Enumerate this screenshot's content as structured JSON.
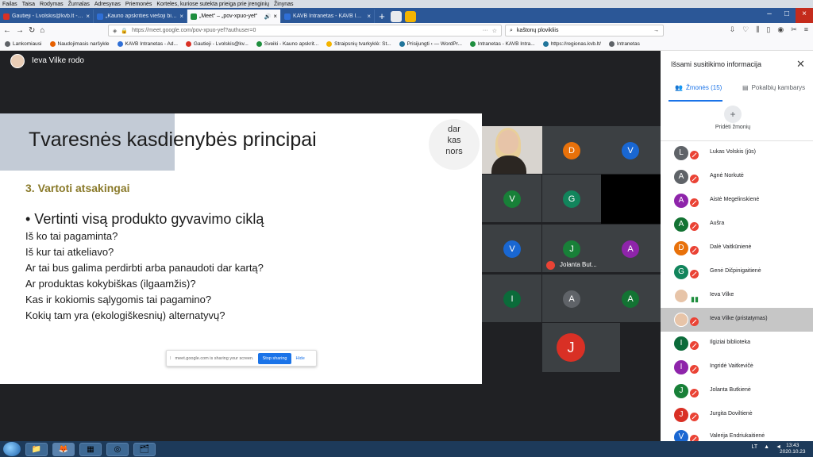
{
  "menu": [
    "Failas",
    "Taisa",
    "Rodymas",
    "Žurnalas",
    "Adresynas",
    "Priemonės",
    "Korteles, kuriose sutekta prieiga prie įrenginių",
    "Žinynas"
  ],
  "tabs": [
    {
      "title": "Gautieji - Lvolskis@kvb.lt - Kaun",
      "color": "#d93025"
    },
    {
      "title": "„Kauno apskrities viešoji biblioteka",
      "color": "#2f6fd6"
    },
    {
      "title": "„Meet“ – „pov-xpuo-yef“",
      "color": "#1e8e3e",
      "active": true
    },
    {
      "title": "KAVB Intranetas - KAVB Intranet",
      "color": "#2f6fd6"
    }
  ],
  "url": "https://meet.google.com/pov-xpuo-yef?authuser=0",
  "search_value": "kaštonų plovikliis",
  "bookmarks": [
    "Lankomiausi",
    "Naudojimasis naršykle",
    "KAVB Intranetas - Ad...",
    "Gautieji - Lvolskis@kv...",
    "Sveiki - Kauno apskrit...",
    "Straipsnių tvarkyklė: St...",
    "Prisijungti ‹ — WordPr...",
    "Intranetas - KAVB Intra...",
    "https://regionas.kvb.lt/",
    "Intranetas"
  ],
  "presenter": "Ieva Vilke rodo",
  "slide": {
    "title": "Tvaresnės kasdienybės principai",
    "logo": [
      "dar",
      "kas",
      "nors"
    ],
    "subtitle": "3. Vartoti atsakingai",
    "bullet": "• Vertinti visą produkto gyvavimo ciklą",
    "questions": [
      "Iš ko tai pagaminta?",
      "Iš kur tai atkeliavo?",
      "Ar tai bus galima perdirbti arba panaudoti dar kartą?",
      "Ar produktas kokybiškas (ilgaamžis)?",
      "Kas ir kokiomis sąlygomis tai pagamino?",
      "Kokių tam yra (ekologiškesnių) alternatyvų?"
    ]
  },
  "sharebar": {
    "text": "meet.google.com is sharing your screen.",
    "stop": "Stop sharing",
    "hide": "Hide"
  },
  "tiles": [
    {
      "letter": "D",
      "color": "#e8710a"
    },
    {
      "letter": "V",
      "color": "#1967d2"
    },
    {
      "letter": "V",
      "color": "#188038"
    },
    {
      "letter": "G",
      "color": "#12855c"
    },
    {
      "letter": "V",
      "color": "#1967d2"
    },
    {
      "letter": "J",
      "color": "#188038"
    },
    {
      "letter": "A",
      "color": "#8e24aa"
    },
    {
      "letter": "I",
      "color": "#0b6b3a"
    },
    {
      "letter": "A",
      "color": "#5f6368"
    },
    {
      "letter": "A",
      "color": "#137333"
    },
    {
      "letter": "J",
      "color": "#d93025"
    }
  ],
  "jolanta_label": "Jolanta But...",
  "panel": {
    "title": "Išsami susitikimo informacija",
    "tab_people": "Žmonės (15)",
    "tab_chat": "Pokalbių kambarys",
    "add_people": "Pridėti žmonių",
    "people": [
      {
        "initial": "L",
        "name": "Lukas Volskis (jūs)",
        "color": "#5f6368",
        "muted": true
      },
      {
        "initial": "A",
        "name": "Agnė Norkutė",
        "color": "#5f6368",
        "muted": true
      },
      {
        "initial": "A",
        "name": "Aistė Megelinskienė",
        "color": "#8e24aa",
        "muted": true
      },
      {
        "initial": "A",
        "name": "Aušra",
        "color": "#137333",
        "muted": true
      },
      {
        "initial": "D",
        "name": "Dalė Vaitkūnienė",
        "color": "#e8710a",
        "muted": true
      },
      {
        "initial": "G",
        "name": "Genė Dičpinigaitienė",
        "color": "#12855c",
        "muted": true
      },
      {
        "initial": "",
        "name": "Ieva Vilke",
        "color": "#e7c4a8",
        "muted": false
      },
      {
        "initial": "",
        "name": "Ieva Vilke (pristatymas)",
        "color": "#e7c4a8",
        "muted": true,
        "highlight": true
      },
      {
        "initial": "I",
        "name": "Ilgiziai biblioteka",
        "color": "#0b6b3a",
        "muted": true
      },
      {
        "initial": "I",
        "name": "Ingridė Vaitkevičė",
        "color": "#8e24aa",
        "muted": true
      },
      {
        "initial": "J",
        "name": "Jolanta Butkienė",
        "color": "#188038",
        "muted": true
      },
      {
        "initial": "J",
        "name": "Jurgita Doviltienė",
        "color": "#d93025",
        "muted": true
      },
      {
        "initial": "V",
        "name": "Valerija Endriukaitienė",
        "color": "#1967d2",
        "muted": true
      }
    ]
  },
  "taskbar": {
    "lang": "LT",
    "time": "13:43",
    "date": "2020.10.23"
  }
}
